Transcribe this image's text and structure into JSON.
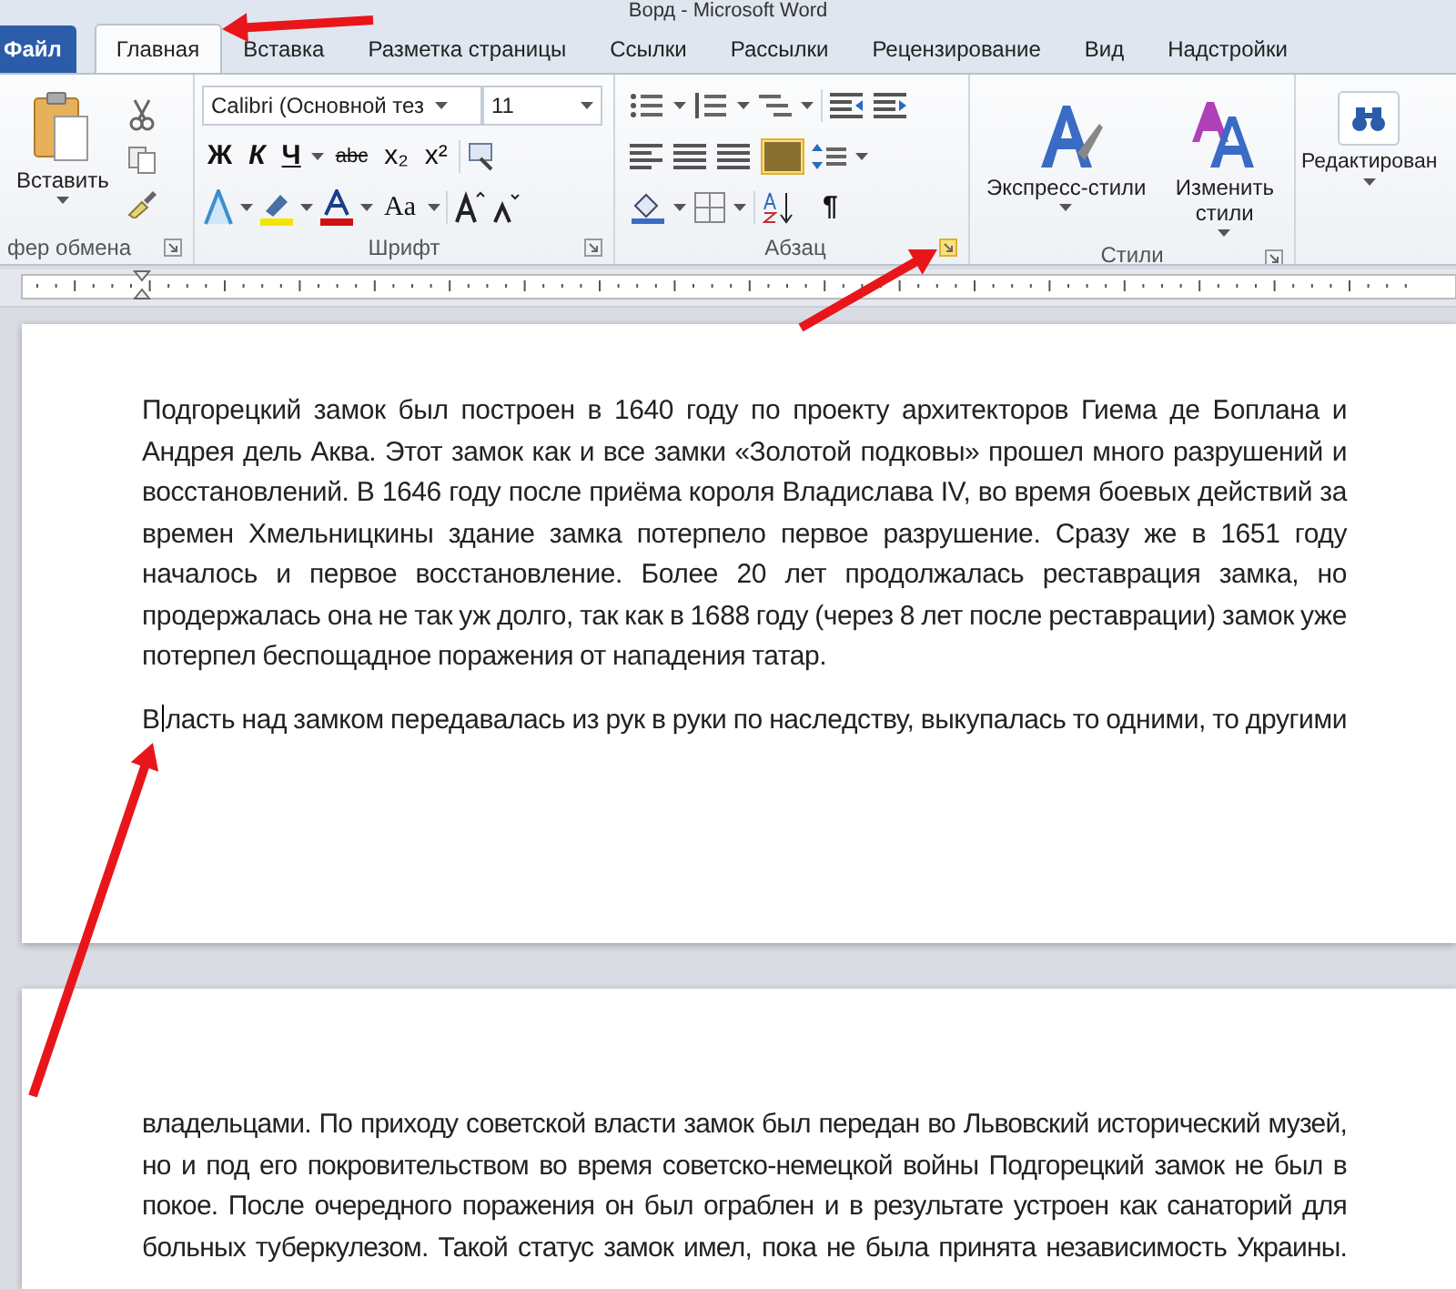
{
  "window": {
    "title": "Ворд - Microsoft Word"
  },
  "file_tab": {
    "label": "Файл"
  },
  "tabs": [
    {
      "label": "Главная",
      "selected": true
    },
    {
      "label": "Вставка",
      "selected": false
    },
    {
      "label": "Разметка страницы",
      "selected": false
    },
    {
      "label": "Ссылки",
      "selected": false
    },
    {
      "label": "Рассылки",
      "selected": false
    },
    {
      "label": "Рецензирование",
      "selected": false
    },
    {
      "label": "Вид",
      "selected": false
    },
    {
      "label": "Надстройки",
      "selected": false
    }
  ],
  "ribbon": {
    "groups": [
      {
        "kind": "clipboard",
        "label": "фер обмена",
        "buttons": [
          "Вставить"
        ]
      },
      {
        "kind": "font",
        "label": "Шрифт",
        "font_name": "Calibri (Основной тез",
        "font_size": "11",
        "format_buttons": [
          {
            "kind": "bold",
            "label": "Ж"
          },
          {
            "kind": "italic",
            "label": "К"
          },
          {
            "kind": "underline",
            "label": "Ч"
          },
          {
            "kind": "strike",
            "label": "abc"
          },
          {
            "kind": "subscript",
            "label": "x₂"
          },
          {
            "kind": "superscript",
            "label": "x²"
          }
        ],
        "case_button": "Aa"
      },
      {
        "kind": "paragraph",
        "label": "Абзац",
        "pilcrow": "¶"
      },
      {
        "kind": "styles",
        "label": "Стили",
        "buttons": [
          "Экспресс-стили",
          "Изменить стили"
        ]
      },
      {
        "kind": "editing",
        "buttons": [
          "Редактирован"
        ]
      }
    ]
  },
  "pages": [
    {
      "paragraphs": [
        {
          "text": "Подгорецкий замок был построен в 1640 году по проекту архитекторов Гиема де Боплана и Андрея дель Аква. Этот замок как и все замки «Золотой подковы» прошел много разрушений и восстановлений. В 1646 году после приёма короля Владислава IV, во время боевых действий за времен Хмельницкины здание замка потерпело первое разрушение. Сразу же в 1651 году началось и первое восстановление. Более 20 лет продолжалась реставрация замка, но продержалась она не так уж долго, так как в 1688 году (через 8 лет после реставрации) замок уже потерпел беспощадное поражения от нападения татар.",
          "continues": false
        },
        {
          "before_caret": "В",
          "text": "ласть над замком передавалась из рук в руки по наследству, выкупалась то одними, то другими",
          "continues": true
        }
      ]
    },
    {
      "paragraphs": [
        {
          "text": "владельцами. По приходу советской власти замок был передан во Львовский исторический музей, но и под его покровительством во время советско-немецкой войны Подгорецкий замок не был в покое. После очередного поражения он был ограблен и в результате устроен как санаторий для больных туберкулезом. Такой статус замок имел, пока не была принята независимость Украины.",
          "continues": true
        }
      ]
    }
  ]
}
